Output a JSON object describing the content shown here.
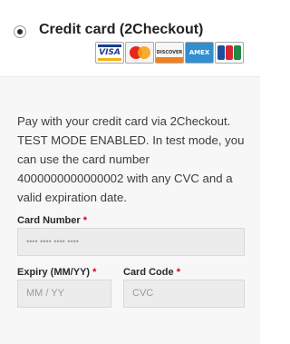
{
  "payment_method": {
    "title": "Credit card (2Checkout)",
    "selected": true,
    "card_logos": [
      {
        "name": "visa-logo",
        "text": "VISA"
      },
      {
        "name": "mastercard-logo",
        "text": "MasterCard"
      },
      {
        "name": "discover-logo",
        "text": "DISCOVER"
      },
      {
        "name": "amex-logo",
        "text": "AMEX"
      },
      {
        "name": "jcb-logo",
        "text": "JCB"
      }
    ]
  },
  "payment_box": {
    "description": "Pay with your credit card via 2Checkout. TEST MODE ENABLED. In test mode, you can use the card number 4000000000000002 with any CVC and a valid expiration date.",
    "card_number": {
      "label": "Card Number",
      "required_mark": "*",
      "placeholder": "•••• •••• •••• ••••"
    },
    "expiry": {
      "label": "Expiry (MM/YY)",
      "required_mark": "*",
      "placeholder": "MM / YY"
    },
    "cvc": {
      "label": "Card Code",
      "required_mark": "*",
      "placeholder": "CVC"
    }
  }
}
